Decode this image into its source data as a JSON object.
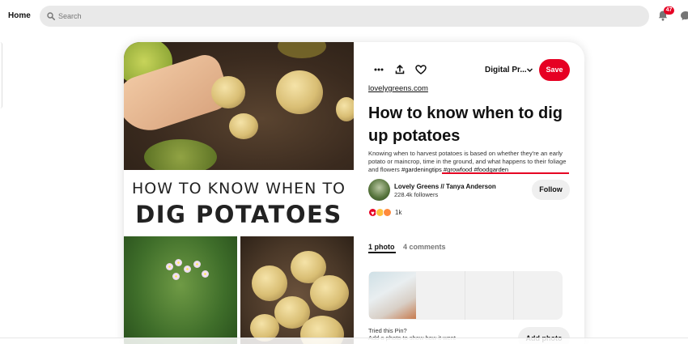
{
  "header": {
    "home_label": "Home",
    "search_placeholder": "Search",
    "notification_count": "47",
    "icons": [
      "search-icon",
      "bell-icon",
      "chat-icon"
    ]
  },
  "pin": {
    "image_text_line1": "HOW TO KNOW WHEN TO",
    "image_text_line2": "DIG POTATOES",
    "board_name": "Digital Pr...",
    "save_label": "Save",
    "source_link": "lovelygreens.com",
    "title": "How to know when to dig up potatoes",
    "description": "Knowing when to harvest potatoes is based on whether they're an early potato or maincrop, time in the ground, and what happens to their foliage and flowers",
    "hashtags": "#gardeningtips #growfood #foodgarden",
    "author_name": "Lovely Greens // Tanya Anderson",
    "author_followers": "228.4k followers",
    "follow_label": "Follow",
    "reaction_count": "1k",
    "tabs": {
      "photos": "1 photo",
      "comments": "4 comments"
    },
    "tried_title": "Tried this Pin?",
    "tried_sub": "Add a photo to show how it went",
    "add_photo_label": "Add photo"
  },
  "colors": {
    "accent": "#e60023",
    "search_bg": "#e9e9e9",
    "button_grey": "#efefef"
  }
}
